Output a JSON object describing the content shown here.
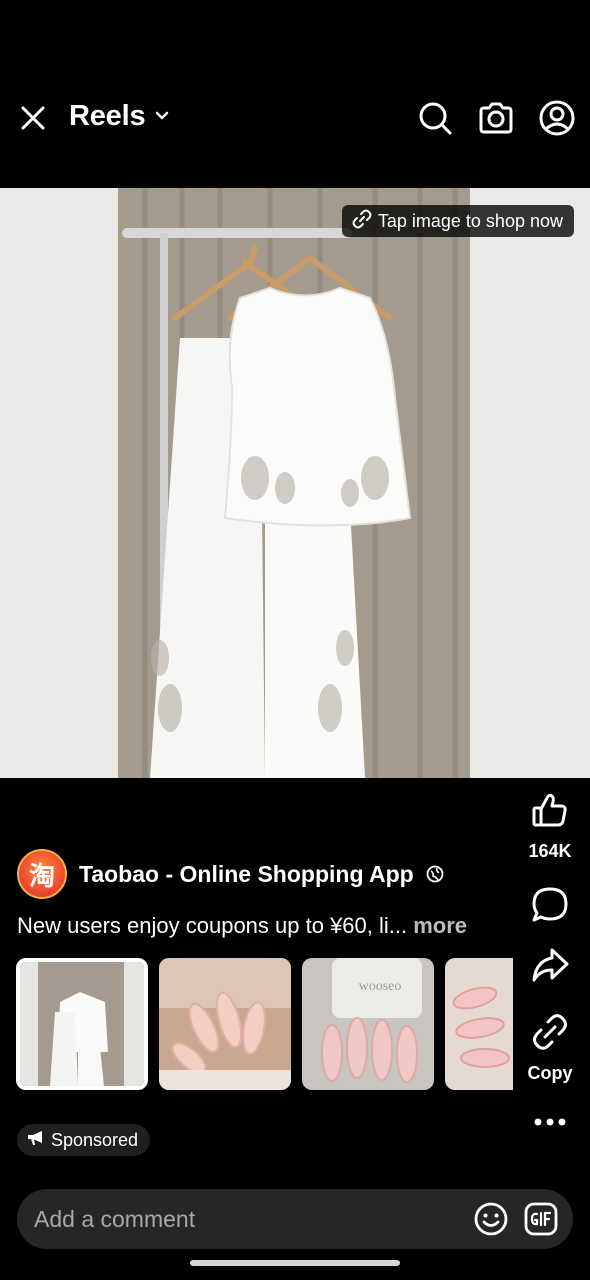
{
  "header": {
    "title": "Reels",
    "icons": [
      "close-icon",
      "chevron-down-icon",
      "search-icon",
      "camera-icon",
      "profile-icon"
    ]
  },
  "media": {
    "shop_label": "Tap image to shop now",
    "image_text": "wooseo"
  },
  "rail": {
    "like_count": "164K",
    "copy_label": "Copy"
  },
  "post": {
    "author": "Taobao - Online Shopping App",
    "avatar_glyph": "淘",
    "caption": "New users enjoy coupons up to ¥60, li...",
    "more_label": "more",
    "sponsored_label": "Sponsored"
  },
  "comment": {
    "placeholder": "Add a comment"
  },
  "colors": {
    "background": "#000000",
    "pill": "#262626",
    "muted_text": "#a8a8a8"
  }
}
